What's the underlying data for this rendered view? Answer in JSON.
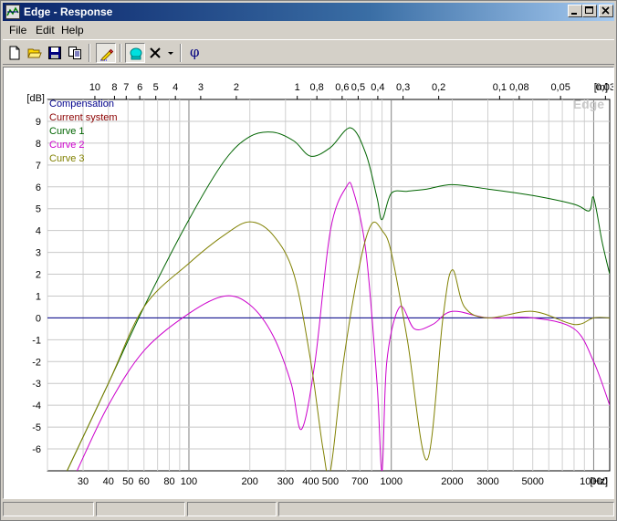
{
  "window": {
    "title": "Edge - Response",
    "controls": [
      "minimize",
      "maximize",
      "close"
    ]
  },
  "menu": [
    "File",
    "Edit",
    "Help"
  ],
  "toolbar": {
    "icons": [
      "new-file-icon",
      "open-folder-icon",
      "save-icon",
      "copy-icon",
      "pencil-icon",
      "cyan-shape-icon",
      "delete-x-icon",
      "dropdown-arrow-icon",
      "phase-icon"
    ],
    "phase_symbol": "φ"
  },
  "chart": {
    "watermark": "Edge",
    "colors": {
      "compensation": "#00008b",
      "current_system": "#8b0000",
      "curve1": "#006400",
      "curve2": "#cc00cc",
      "curve3": "#808000"
    }
  },
  "chart_data": {
    "type": "line",
    "x_scale": "log",
    "xlim": [
      20,
      12000
    ],
    "ylim": [
      -7,
      10
    ],
    "x_unit_label": "[Hz]",
    "y_unit_label": "[dB]",
    "top_unit_label": "[m]",
    "x_ticks": [
      30,
      40,
      50,
      60,
      80,
      100,
      200,
      300,
      400,
      500,
      700,
      1000,
      2000,
      3000,
      5000,
      10000
    ],
    "y_ticks": [
      9,
      8,
      7,
      6,
      5,
      4,
      3,
      2,
      1,
      0,
      -1,
      -2,
      -3,
      -4,
      -5,
      -6
    ],
    "top_ticks": [
      "10",
      "8",
      "7",
      "6",
      "5",
      "4",
      "3",
      "2",
      "1",
      "0,8",
      "0,6",
      "0,5",
      "0,4",
      "0,3",
      "0,2",
      "0,1",
      "0,08",
      "0,05",
      "0,03"
    ],
    "grid": true,
    "legend_position": "top-left",
    "series": [
      {
        "name": "Compensation",
        "x": [
          20,
          12000
        ],
        "y": [
          0,
          0
        ]
      },
      {
        "name": "Current system",
        "x": [],
        "y": []
      },
      {
        "name": "Curve 1",
        "x": [
          25,
          40,
          60,
          100,
          150,
          200,
          260,
          330,
          400,
          500,
          630,
          750,
          850,
          900,
          1000,
          1200,
          1500,
          2000,
          3000,
          5000,
          8000,
          9500,
          10000,
          11000,
          12000
        ],
        "y": [
          -7,
          -3,
          0.5,
          4.5,
          7.2,
          8.3,
          8.5,
          8.1,
          7.4,
          7.8,
          8.7,
          7.5,
          5.5,
          4.5,
          5.7,
          5.8,
          5.9,
          6.1,
          5.9,
          5.6,
          5.2,
          4.9,
          5.5,
          3.5,
          2.0
        ]
      },
      {
        "name": "Curve 2",
        "x": [
          28,
          40,
          60,
          100,
          150,
          200,
          260,
          320,
          360,
          420,
          500,
          600,
          650,
          750,
          850,
          900,
          950,
          1100,
          1300,
          1600,
          2000,
          3000,
          5000,
          8000,
          10000,
          12000
        ],
        "y": [
          -7,
          -4,
          -1.5,
          0.2,
          1.0,
          0.6,
          -0.8,
          -3.0,
          -5.1,
          -2.0,
          4.0,
          6.0,
          5.8,
          3.0,
          -3.0,
          -7.0,
          -2.0,
          0.5,
          -0.5,
          -0.3,
          0.3,
          0,
          0,
          -0.5,
          -2.0,
          -4.0
        ]
      },
      {
        "name": "Curve 3",
        "x": [
          25,
          40,
          60,
          100,
          150,
          200,
          260,
          330,
          400,
          460,
          500,
          580,
          700,
          800,
          900,
          1000,
          1200,
          1500,
          1800,
          2000,
          2300,
          3000,
          5000,
          8000,
          10000,
          12000
        ],
        "y": [
          -7,
          -3,
          0.5,
          2.5,
          3.8,
          4.4,
          3.8,
          2.0,
          -2.0,
          -6.0,
          -7.0,
          -2.0,
          2.5,
          4.3,
          4.0,
          3.0,
          -1.0,
          -6.5,
          0,
          2.2,
          0.5,
          0,
          0.3,
          -0.3,
          0,
          0
        ]
      }
    ]
  }
}
